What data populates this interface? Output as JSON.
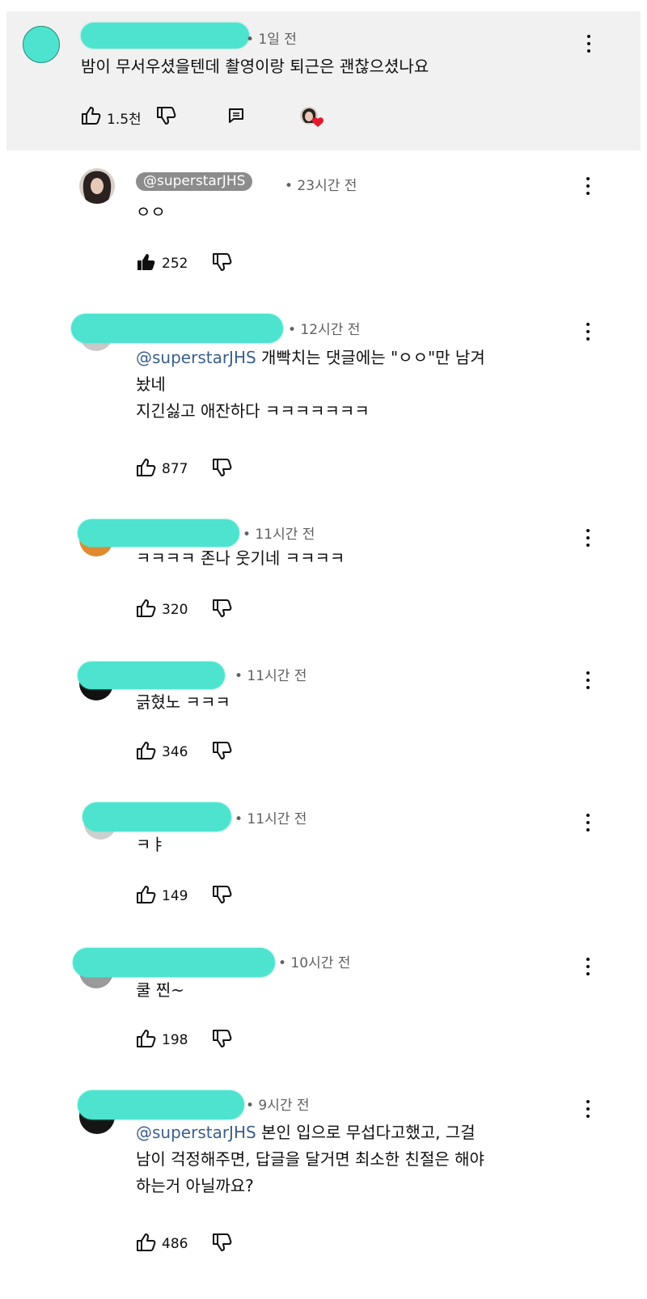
{
  "top_comment": {
    "time": "• 1일 전",
    "text": "밤이 무서우셨을텐데 촬영이랑 퇴근은 괜찮으셨나요",
    "like_count": "1.5천"
  },
  "replies": [
    {
      "handle": "@superstarJHS",
      "time": "• 23시간 전",
      "text": "ㅇㅇ",
      "like_count": "252",
      "liked": true
    },
    {
      "time": "• 12시간 전",
      "mention": "@superstarJHS",
      "text_line1": " 개빡치는 댓글에는 \"ㅇㅇ\"만 남겨",
      "text_line2": "놨네",
      "text_line3": "지긴싫고 애잔하다 ㅋㅋㅋㅋㅋㅋㅋ",
      "like_count": "877"
    },
    {
      "time": "• 11시간 전",
      "text": "ㅋㅋㅋㅋ 존나 웃기네 ㅋㅋㅋㅋ",
      "like_count": "320"
    },
    {
      "time": "• 11시간 전",
      "text": "긁혔노 ㅋㅋㅋ",
      "like_count": "346"
    },
    {
      "time": "• 11시간 전",
      "text": "ㅋㅑ",
      "like_count": "149"
    },
    {
      "time": "• 10시간 전",
      "text": "쿨 찐~",
      "like_count": "198"
    },
    {
      "time": "• 9시간 전",
      "mention": "@superstarJHS",
      "text_line1": " 본인 입으로 무섭다고했고, 그걸",
      "text_line2": "남이 걱정해주면, 답글을 달거면 최소한 친절은 해야",
      "text_line3": "하는거 아닐까요?",
      "like_count": "486"
    }
  ],
  "icons": [
    "thumb-up-icon",
    "thumb-down-icon",
    "reply-icon",
    "creator-heart-icon",
    "more-vert-icon"
  ],
  "colors": {
    "redaction": "#4ee3cf",
    "mention": "#3a5f8a",
    "top_comment_bg": "#f1f1f1",
    "handle_chip": "#8c8c8c"
  }
}
